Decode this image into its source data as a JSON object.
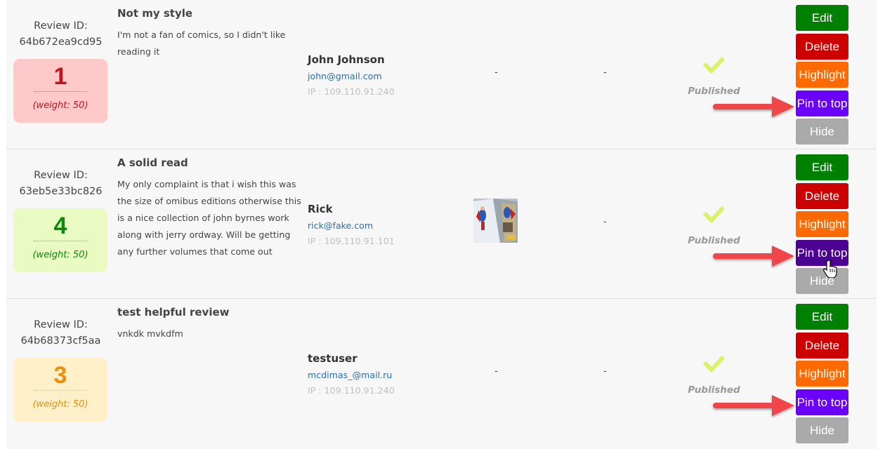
{
  "labels": {
    "review_id": "Review ID:",
    "ip_prefix": "IP : ",
    "empty": "-"
  },
  "colors": {
    "row_bg": "#f7f7f7",
    "edit": "#008000",
    "delete": "#cc0000",
    "highlight": "#ff6a00",
    "pin": "#6b00ff",
    "pin_hover": "#4b0092",
    "hide": "#aaaaaa",
    "check": "#d9f26a",
    "arrow": "#f0444a",
    "email": "#2a6fb0"
  },
  "reviews": [
    {
      "id": "64b672ea9cd95",
      "rating": "1",
      "weight": "(weight: 50)",
      "rating_bg": "#ffc9c9",
      "rating_fg": "#c0141e",
      "title": "Not my style",
      "body": "I'm not a fan of comics, so I didn't like reading it",
      "user_name": "John Johnson",
      "user_email": "john@gmail.com",
      "user_ip": "IP : 109.110.91.240",
      "media": "-",
      "has_image": false,
      "extra": "-",
      "status": "Published",
      "status_icon": "check-icon",
      "actions": [
        "Edit",
        "Delete",
        "Highlight",
        "Pin to top",
        "Hide"
      ],
      "pin_hovered": false
    },
    {
      "id": "63eb5e33bc826",
      "rating": "4",
      "weight": "(weight: 50)",
      "rating_bg": "#e9fac2",
      "rating_fg": "#0a8a0a",
      "title": "A solid read",
      "body": "My only complaint is that i wish this was the size of omibus editions otherwise this is a nice collection of john byrnes work along with jerry ordway. Will be getting any further volumes that come out",
      "user_name": "Rick",
      "user_email": "rick@fake.com",
      "user_ip": "IP : 109.110.91.101",
      "media": "comic-book-photo",
      "has_image": true,
      "extra": "-",
      "status": "Published",
      "status_icon": "check-icon",
      "actions": [
        "Edit",
        "Delete",
        "Highlight",
        "Pin to top",
        "Hide"
      ],
      "pin_hovered": true
    },
    {
      "id": "64b68373cf5aa",
      "rating": "3",
      "weight": "(weight: 50)",
      "rating_bg": "#fff0c9",
      "rating_fg": "#e8900c",
      "title": "test helpful review",
      "body": "vnkdk mvkdfm",
      "user_name": "testuser",
      "user_email": "mcdimas_@mail.ru",
      "user_ip": "IP : 109.110.91.240",
      "media": "-",
      "has_image": false,
      "extra": "-",
      "status": "Published",
      "status_icon": "check-icon",
      "actions": [
        "Edit",
        "Delete",
        "Highlight",
        "Pin to top",
        "Hide"
      ],
      "pin_hovered": false
    }
  ]
}
